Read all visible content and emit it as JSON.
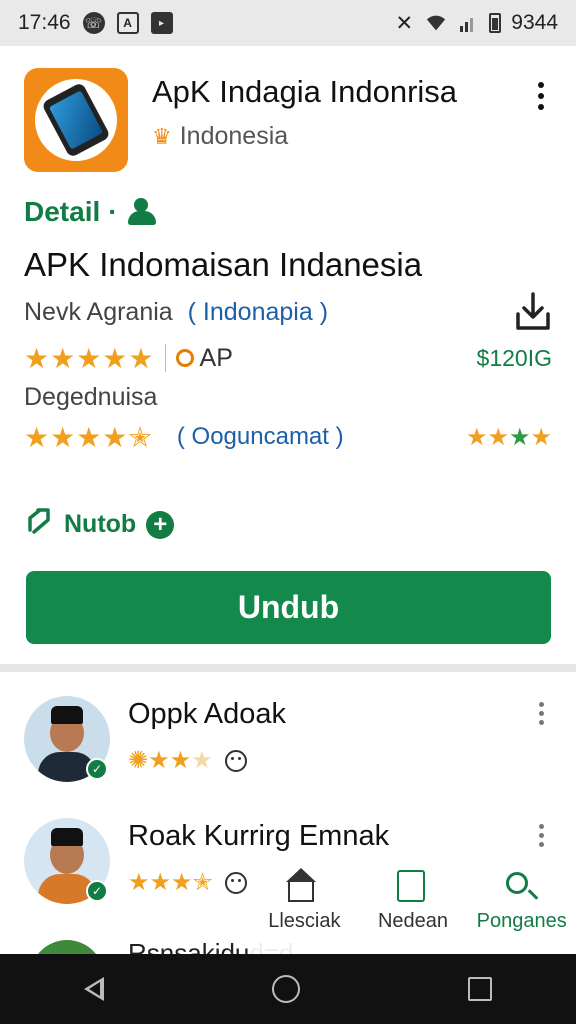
{
  "status_bar": {
    "time": "17:46",
    "battery_text": "9344",
    "icons": [
      "whatsapp-icon",
      "font-icon",
      "media-icon",
      "mute-icon",
      "wifi-icon",
      "signal-icon",
      "battery-icon"
    ]
  },
  "app": {
    "title": "ApK Indagia Indonrisa",
    "region": "Indonesia",
    "icon": "phone-app-icon",
    "accent_color": "#f28a17"
  },
  "detail": {
    "label": "Detail",
    "title": "APK Indomaisan Indanesia",
    "developer": "Nevk Agrania",
    "developer_link": "( Indonapia )",
    "rating_stars": 4,
    "ap_label": "AP",
    "price": "$120IG",
    "category": "Degednuisa",
    "category_rating": 4.5,
    "category_link": "( Ooguncamat )",
    "nutob_label": "Nutob",
    "download_button": "Undub",
    "brand_color": "#138a4c"
  },
  "reviews": [
    {
      "name": "Oppk Adoak",
      "rating": 3,
      "avatar": "man-hat-avatar"
    },
    {
      "name": "Roak Kurrirg Emnak",
      "rating": 3.5,
      "avatar": "man-orange-avatar"
    }
  ],
  "partial_review": {
    "name": "Rsnsakidud=d"
  },
  "bottom_nav": {
    "items": [
      {
        "label": "Llesciak",
        "icon": "home-icon",
        "active": false
      },
      {
        "label": "Nedean",
        "icon": "document-icon",
        "active": false
      },
      {
        "label": "Ponganes",
        "icon": "search-icon",
        "active": true
      }
    ]
  },
  "system_nav": [
    "back-icon",
    "home-circle-icon",
    "recents-icon"
  ]
}
